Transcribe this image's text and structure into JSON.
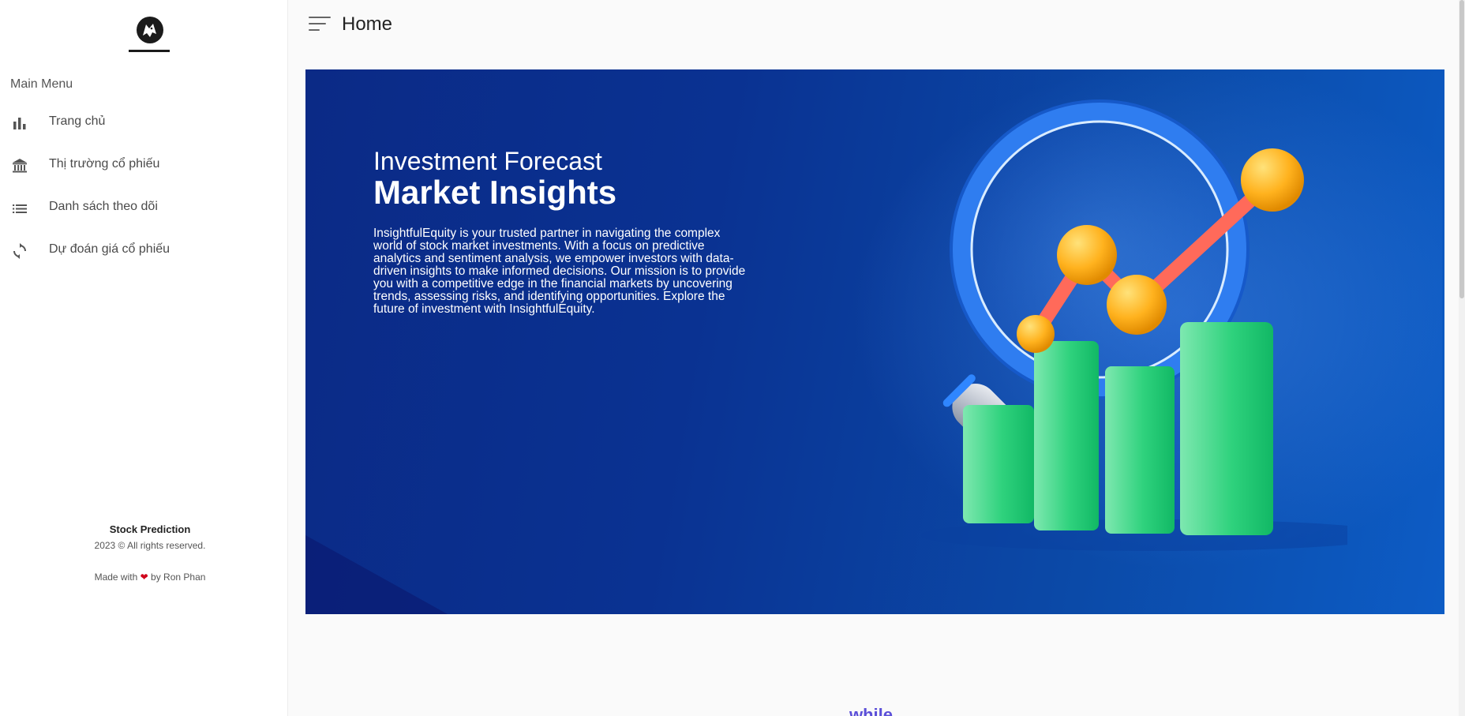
{
  "sidebar": {
    "menu_heading": "Main Menu",
    "items": [
      {
        "label": "Trang chủ",
        "icon": "bar-chart-icon"
      },
      {
        "label": "Thị trường cổ phiếu",
        "icon": "bank-icon"
      },
      {
        "label": "Danh sách theo dõi",
        "icon": "list-icon"
      },
      {
        "label": "Dự đoán giá cổ phiếu",
        "icon": "sync-icon"
      }
    ],
    "footer": {
      "brand": "Stock Prediction",
      "copyright": "2023 © All rights reserved.",
      "made_prefix": "Made with",
      "made_suffix": "by Ron Phan"
    }
  },
  "header": {
    "title": "Home"
  },
  "hero": {
    "subtitle": "Investment Forecast",
    "title": "Market Insights",
    "description": "InsightfulEquity is your trusted partner in navigating the complex world of stock market investments. With a focus on predictive analytics and sentiment analysis, we empower investors with data-driven insights to make informed decisions. Our mission is to provide you with a competitive edge in the financial markets by uncovering trends, assessing risks, and identifying opportunities. Explore the future of investment with InsightfulEquity."
  },
  "below_fold": {
    "cropped_text": "while"
  },
  "colors": {
    "hero_bg": "#0b3a9a",
    "accent_purple": "#5b4fd8",
    "heart": "#d0021b"
  }
}
